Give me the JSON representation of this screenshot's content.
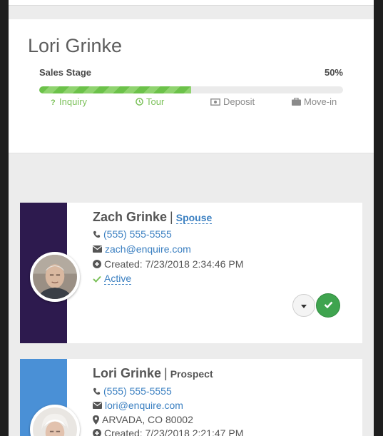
{
  "lead": {
    "name": "Lori Grinke",
    "sales_stage_label": "Sales Stage",
    "sales_stage_percent": "50%",
    "progress": 0.5,
    "steps": [
      {
        "label": "Inquiry",
        "icon": "question-icon",
        "done": true
      },
      {
        "label": "Tour",
        "icon": "clock-icon",
        "done": true
      },
      {
        "label": "Deposit",
        "icon": "money-icon",
        "done": false
      },
      {
        "label": "Move-in",
        "icon": "briefcase-icon",
        "done": false
      }
    ]
  },
  "contacts": [
    {
      "name": "Zach Grinke",
      "separator": "|",
      "relationship": "Spouse",
      "phone": "(555) 555-5555",
      "email": "zach@enquire.com",
      "created": "Created: 7/23/2018 2:34:46 PM",
      "status": "Active",
      "accent_color": "#2d1a4e"
    },
    {
      "name": "Lori Grinke",
      "separator": "|",
      "relationship": "Prospect",
      "phone": "(555) 555-5555",
      "email": "lori@enquire.com",
      "location": "ARVADA, CO 80002",
      "created": "Created: 7/23/2018 2:21:47 PM",
      "accent_color": "#4a90d6"
    }
  ],
  "colors": {
    "progress_green": "#6cc24a",
    "link_blue": "#3a7fc1",
    "confirm_green": "#3fa44f"
  }
}
